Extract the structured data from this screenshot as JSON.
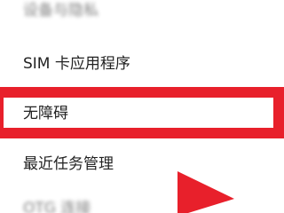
{
  "settings_list": {
    "items": [
      {
        "label": "设备与隐私",
        "blurred": true
      },
      {
        "label": "SIM 卡应用程序",
        "blurred": false
      },
      {
        "label": "无障碍",
        "blurred": false,
        "highlighted": true
      },
      {
        "label": "最近任务管理",
        "blurred": false
      },
      {
        "label": "OTG 连接",
        "blurred": true
      }
    ]
  },
  "annotation": {
    "highlight_color": "#e8202b",
    "pointer": "arrow-icon"
  }
}
